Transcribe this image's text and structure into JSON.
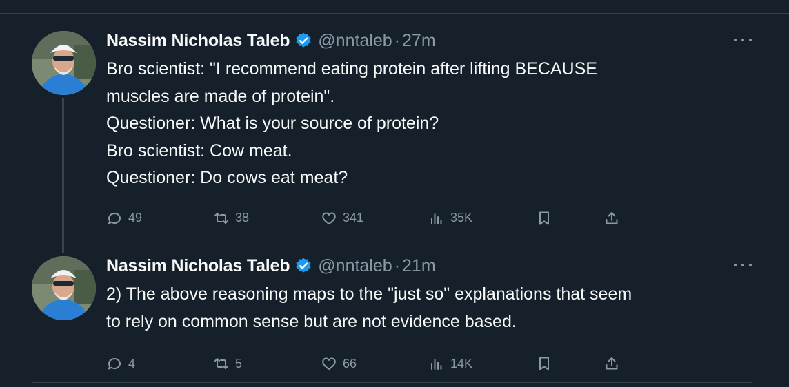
{
  "colors": {
    "background": "#15202b",
    "text": "#f7f9f9",
    "muted": "#8b98a5",
    "verified": "#1d9bf0",
    "divider": "#38444d"
  },
  "tweets": [
    {
      "name": "Nassim Nicholas Taleb",
      "handle": "@nntaleb",
      "separator": "·",
      "time": "27m",
      "lines": [
        "Bro scientist: \"I recommend eating protein after lifting BECAUSE",
        "muscles are made of protein\".",
        "Questioner: What is your source of protein?",
        "Bro scientist: Cow meat.",
        "Questioner: Do cows eat meat?"
      ],
      "replies": "49",
      "retweets": "38",
      "likes": "341",
      "views": "35K"
    },
    {
      "name": "Nassim Nicholas Taleb",
      "handle": "@nntaleb",
      "separator": "·",
      "time": "21m",
      "lines": [
        "2) The above reasoning maps to the \"just so\" explanations that seem",
        "to rely on common sense but are not evidence based."
      ],
      "replies": "4",
      "retweets": "5",
      "likes": "66",
      "views": "14K"
    }
  ],
  "icons": [
    "more-icon",
    "verified-icon",
    "reply-icon",
    "retweet-icon",
    "like-icon",
    "views-icon",
    "bookmark-icon",
    "share-icon"
  ]
}
